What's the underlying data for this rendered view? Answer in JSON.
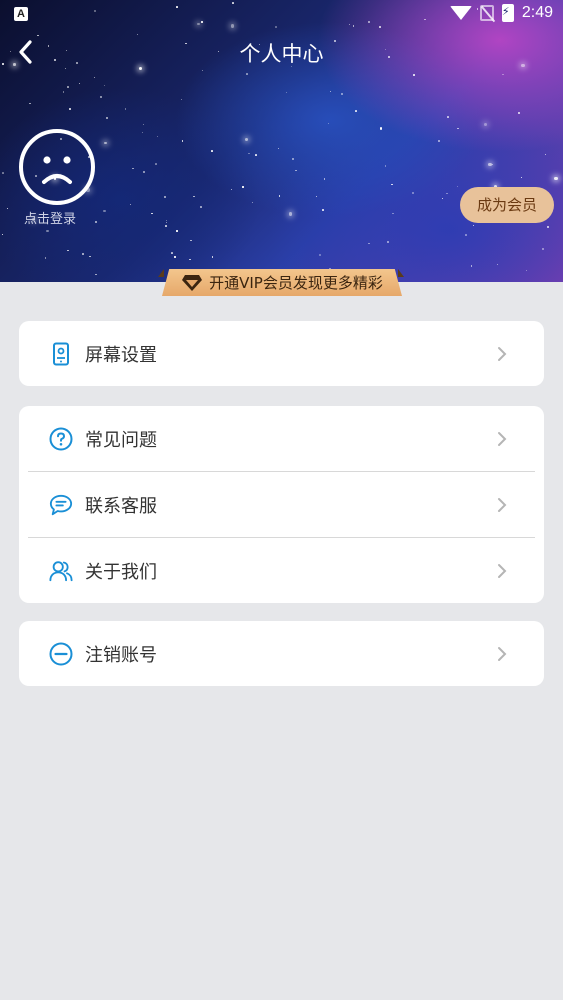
{
  "status_bar": {
    "time": "2:49",
    "app_icon_letter": "A"
  },
  "header": {
    "title": "个人中心"
  },
  "profile": {
    "login_text": "点击登录",
    "become_member_label": "成为会员"
  },
  "vip_banner": {
    "text": "开通VIP会员发现更多精彩"
  },
  "menu": {
    "group1": [
      {
        "label": "屏幕设置",
        "icon": "phone-screen-icon"
      }
    ],
    "group2": [
      {
        "label": "常见问题",
        "icon": "question-circle-icon"
      },
      {
        "label": "联系客服",
        "icon": "chat-bubble-icon"
      },
      {
        "label": "关于我们",
        "icon": "users-icon"
      }
    ],
    "group3": [
      {
        "label": "注销账号",
        "icon": "minus-circle-icon"
      }
    ]
  },
  "colors": {
    "accent_blue": "#1a8fd6",
    "vip_gold": "#e8c29a",
    "page_bg": "#e6e7ea"
  }
}
